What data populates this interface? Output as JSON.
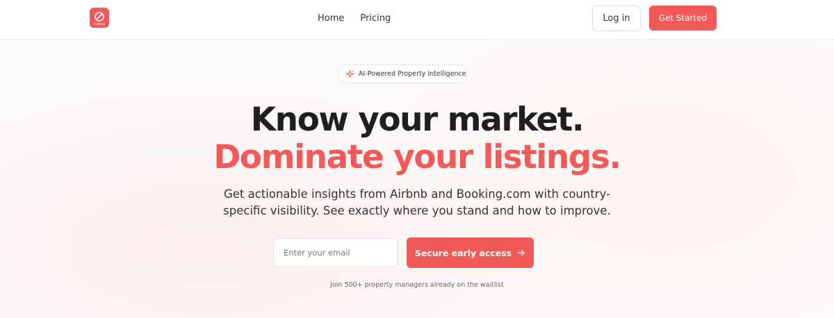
{
  "brand": {
    "logo_text": "AirbMax",
    "logo_icon": "no-link-icon",
    "color": "#f25a5a"
  },
  "nav": {
    "links": [
      "Home",
      "Pricing"
    ],
    "login_label": "Log in",
    "cta_label": "Get Started"
  },
  "hero": {
    "badge_icon": "sparkle-icon",
    "badge": "AI-Powered Property Intelligence",
    "headline_line1": "Know your market.",
    "headline_line2": "Dominate your listings.",
    "subheadline": "Get actionable insights from Airbnb and Booking.com with country-specific visibility. See exactly where you stand and how to improve.",
    "email_placeholder": "Enter your email",
    "cta_label": "Secure early access",
    "cta_icon": "arrow-right-icon",
    "waitlist_note": "Join 500+ property managers already on the waitlist"
  }
}
